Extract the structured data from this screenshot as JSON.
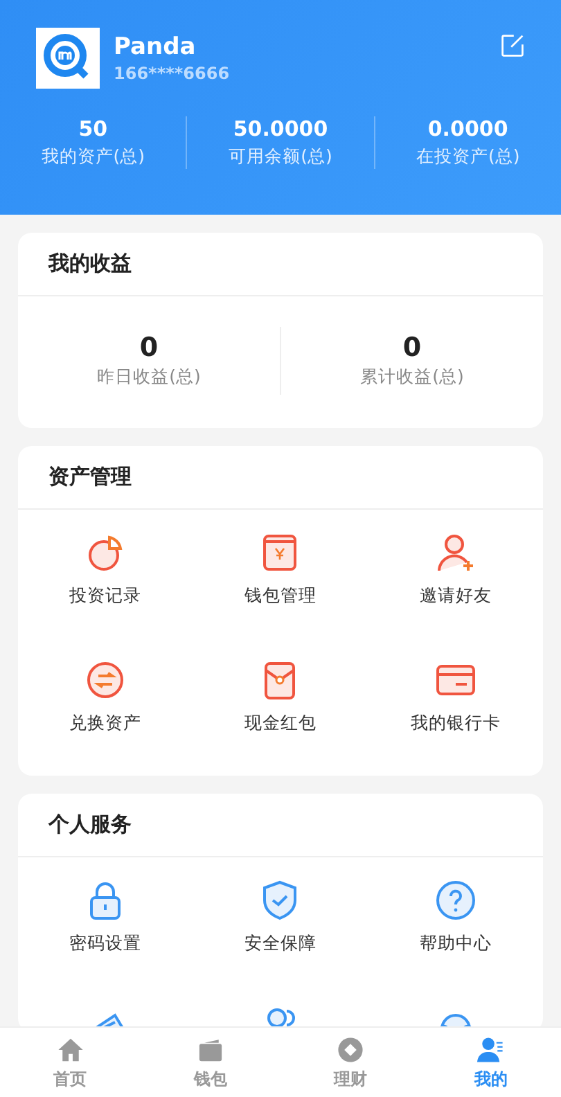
{
  "profile": {
    "name": "Panda",
    "phone": "166****6666"
  },
  "summary": [
    {
      "value": "50",
      "label": "我的资产(总)"
    },
    {
      "value": "50.0000",
      "label": "可用余额(总)"
    },
    {
      "value": "0.0000",
      "label": "在投资产(总)"
    }
  ],
  "earnings": {
    "title": "我的收益",
    "stats": [
      {
        "value": "0",
        "label": "昨日收益(总)"
      },
      {
        "value": "0",
        "label": "累计收益(总)"
      }
    ]
  },
  "assets": {
    "title": "资产管理",
    "items": [
      {
        "label": "投资记录"
      },
      {
        "label": "钱包管理"
      },
      {
        "label": "邀请好友"
      },
      {
        "label": "兑换资产"
      },
      {
        "label": "现金红包"
      },
      {
        "label": "我的银行卡"
      }
    ]
  },
  "services": {
    "title": "个人服务",
    "items": [
      {
        "label": "密码设置"
      },
      {
        "label": "安全保障"
      },
      {
        "label": "帮助中心"
      }
    ]
  },
  "tabbar": [
    {
      "label": "首页",
      "selected": false
    },
    {
      "label": "钱包",
      "selected": false
    },
    {
      "label": "理财",
      "selected": false
    },
    {
      "label": "我的",
      "selected": true
    }
  ]
}
